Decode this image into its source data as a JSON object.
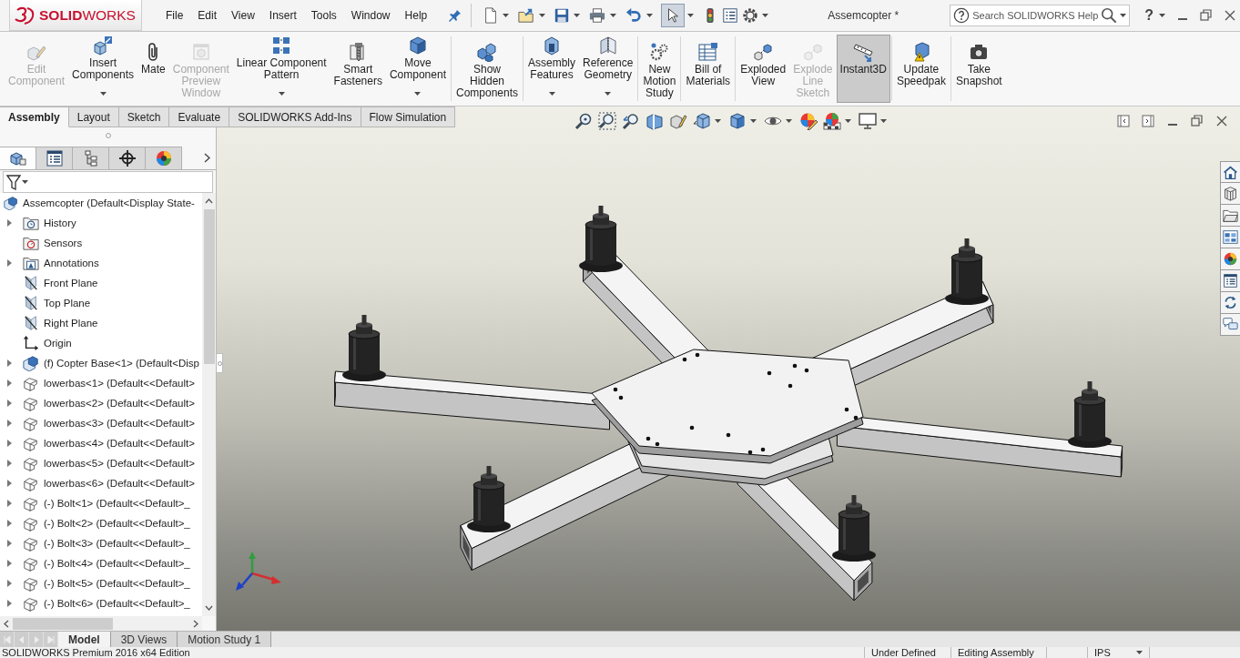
{
  "window": {
    "title": "Assemcopter *"
  },
  "logo": {
    "text": "**SOLID**WORKS"
  },
  "menu": [
    "File",
    "Edit",
    "View",
    "Insert",
    "Tools",
    "Window",
    "Help"
  ],
  "quick_access": {
    "select_on": true
  },
  "search": {
    "placeholder": "Search SOLIDWORKS Help"
  },
  "help": {
    "label": "?"
  },
  "ribbon": {
    "groups": [
      {
        "commands": [
          {
            "label": "Edit\nComponent",
            "disabled": true,
            "dropdown": false,
            "pressed": false
          },
          {
            "label": "Insert\nComponents",
            "disabled": false,
            "dropdown": true,
            "pressed": false
          },
          {
            "label": "Mate",
            "disabled": false,
            "dropdown": false,
            "pressed": false
          },
          {
            "label": "Component\nPreview\nWindow",
            "disabled": true,
            "dropdown": false,
            "pressed": false
          },
          {
            "label": "Linear Component\nPattern",
            "disabled": false,
            "dropdown": true,
            "pressed": false
          },
          {
            "label": "Smart\nFasteners",
            "disabled": false,
            "dropdown": false,
            "pressed": false
          },
          {
            "label": "Move\nComponent",
            "disabled": false,
            "dropdown": true,
            "pressed": false
          }
        ]
      },
      {
        "commands": [
          {
            "label": "Show\nHidden\nComponents",
            "disabled": false,
            "dropdown": false,
            "pressed": false
          }
        ]
      },
      {
        "commands": [
          {
            "label": "Assembly\nFeatures",
            "disabled": false,
            "dropdown": true,
            "pressed": false
          },
          {
            "label": "Reference\nGeometry",
            "disabled": false,
            "dropdown": true,
            "pressed": false
          }
        ]
      },
      {
        "commands": [
          {
            "label": "New\nMotion\nStudy",
            "disabled": false,
            "dropdown": false,
            "pressed": false
          }
        ]
      },
      {
        "commands": [
          {
            "label": "Bill of\nMaterials",
            "disabled": false,
            "dropdown": false,
            "pressed": false
          }
        ]
      },
      {
        "commands": [
          {
            "label": "Exploded\nView",
            "disabled": false,
            "dropdown": false,
            "pressed": false
          },
          {
            "label": "Explode\nLine\nSketch",
            "disabled": true,
            "dropdown": false,
            "pressed": false
          },
          {
            "label": "Instant3D",
            "disabled": false,
            "dropdown": false,
            "pressed": true
          }
        ]
      },
      {
        "commands": [
          {
            "label": "Update\nSpeedpak",
            "disabled": false,
            "dropdown": false,
            "pressed": false
          }
        ]
      },
      {
        "commands": [
          {
            "label": "Take\nSnapshot",
            "disabled": false,
            "dropdown": false,
            "pressed": false
          }
        ]
      }
    ]
  },
  "command_tabs": [
    {
      "label": "Assembly",
      "selected": true
    },
    {
      "label": "Layout",
      "selected": false
    },
    {
      "label": "Sketch",
      "selected": false
    },
    {
      "label": "Evaluate",
      "selected": false
    },
    {
      "label": "SOLIDWORKS Add-Ins",
      "selected": false
    },
    {
      "label": "Flow Simulation",
      "selected": false
    }
  ],
  "feature_manager": {
    "panel_tabs": [
      {
        "selected": true
      },
      {
        "selected": false
      },
      {
        "selected": false
      },
      {
        "selected": false
      },
      {
        "selected": false
      }
    ],
    "tree": {
      "label": "Assemcopter (Default<Display State-",
      "kind": "assembly",
      "children": [
        {
          "label": "History",
          "kind": "history",
          "expanded": false
        },
        {
          "label": "Sensors",
          "kind": "sensors"
        },
        {
          "label": "Annotations",
          "kind": "annotations",
          "expanded": false
        },
        {
          "label": "Front Plane",
          "kind": "plane"
        },
        {
          "label": "Top Plane",
          "kind": "plane"
        },
        {
          "label": "Right Plane",
          "kind": "plane"
        },
        {
          "label": "Origin",
          "kind": "origin"
        },
        {
          "label": "(f) Copter Base<1> (Default<Disp",
          "kind": "assembly",
          "expanded": false
        },
        {
          "label": "lowerbas<1> (Default<<Default>",
          "kind": "part",
          "expanded": false
        },
        {
          "label": "lowerbas<2> (Default<<Default>",
          "kind": "part",
          "expanded": false
        },
        {
          "label": "lowerbas<3> (Default<<Default>",
          "kind": "part",
          "expanded": false
        },
        {
          "label": "lowerbas<4> (Default<<Default>",
          "kind": "part",
          "expanded": false
        },
        {
          "label": "lowerbas<5> (Default<<Default>",
          "kind": "part",
          "expanded": false
        },
        {
          "label": "lowerbas<6> (Default<<Default>",
          "kind": "part",
          "expanded": false
        },
        {
          "label": "(-) Bolt<1> (Default<<Default>_",
          "kind": "part",
          "expanded": false
        },
        {
          "label": "(-) Bolt<2> (Default<<Default>_",
          "kind": "part",
          "expanded": false
        },
        {
          "label": "(-) Bolt<3> (Default<<Default>_",
          "kind": "part",
          "expanded": false
        },
        {
          "label": "(-) Bolt<4> (Default<<Default>_",
          "kind": "part",
          "expanded": false
        },
        {
          "label": "(-) Bolt<5> (Default<<Default>_",
          "kind": "part",
          "expanded": false
        },
        {
          "label": "(-) Bolt<6> (Default<<Default>_",
          "kind": "part",
          "expanded": false
        }
      ]
    }
  },
  "bottom_tabs": [
    {
      "label": "Model",
      "selected": true
    },
    {
      "label": "3D Views",
      "selected": false
    },
    {
      "label": "Motion Study 1",
      "selected": false
    }
  ],
  "status_bar": {
    "product": "SOLIDWORKS Premium 2016 x64 Edition",
    "state": "Under Defined",
    "mode": "Editing Assembly",
    "units": "IPS"
  }
}
